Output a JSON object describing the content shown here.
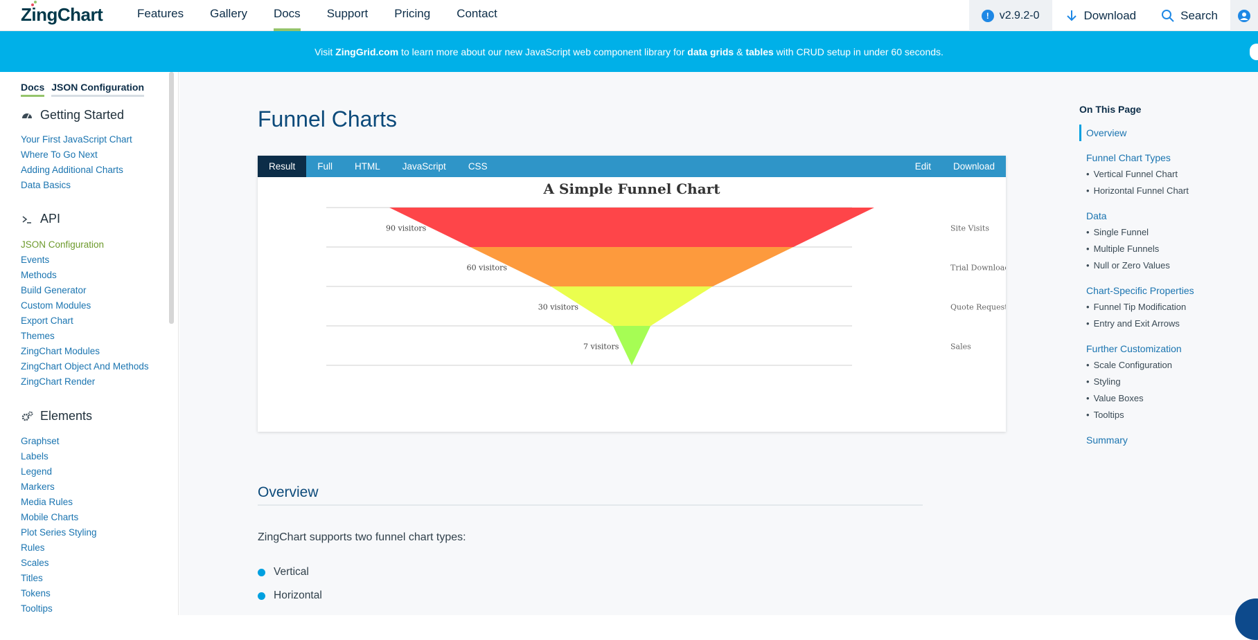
{
  "nav": {
    "logo": "ZingChart",
    "links": [
      "Features",
      "Gallery",
      "Docs",
      "Support",
      "Pricing",
      "Contact"
    ],
    "active": "Docs",
    "version": "v2.9.2-0",
    "download": "Download",
    "search": "Search"
  },
  "banner": {
    "t1": "Visit ",
    "link": "ZingGrid.com",
    "t2": " to learn more about our new JavaScript web component library for ",
    "b1": "data grids",
    "t3": " & ",
    "b2": "tables",
    "t4": " with CRUD setup in under 60 seconds."
  },
  "sidebar": {
    "tabs": [
      "Docs",
      "JSON Configuration"
    ],
    "sections": [
      {
        "title": "Getting Started",
        "icon": "dashboard-icon",
        "items": [
          "Your First JavaScript Chart",
          "Where To Go Next",
          "Adding Additional Charts",
          "Data Basics"
        ]
      },
      {
        "title": "API",
        "icon": "terminal-icon",
        "items": [
          "JSON Configuration",
          "Events",
          "Methods",
          "Build Generator",
          "Custom Modules",
          "Export Chart",
          "Themes",
          "ZingChart Modules",
          "ZingChart Object And Methods",
          "ZingChart Render"
        ]
      },
      {
        "title": "Elements",
        "icon": "gears-icon",
        "items": [
          "Graphset",
          "Labels",
          "Legend",
          "Markers",
          "Media Rules",
          "Mobile Charts",
          "Plot Series Styling",
          "Rules",
          "Scales",
          "Titles",
          "Tokens",
          "Tooltips"
        ]
      }
    ]
  },
  "main": {
    "title": "Funnel Charts",
    "demo_tabs": [
      "Result",
      "Full",
      "HTML",
      "JavaScript",
      "CSS"
    ],
    "demo_actions": [
      "Edit",
      "Download"
    ],
    "overview_heading": "Overview",
    "overview_text": "ZingChart supports two funnel chart types:",
    "overview_items": [
      "Vertical",
      "Horizontal"
    ]
  },
  "chart_data": {
    "type": "funnel",
    "title": "A Simple Funnel Chart",
    "categories": [
      "Site Visits",
      "Trial Downloads",
      "Quote Requests",
      "Sales"
    ],
    "values": [
      90,
      60,
      30,
      7
    ],
    "value_labels": [
      "90 visitors",
      "60 visitors",
      "30 visitors",
      "7 visitors"
    ],
    "colors": [
      "#fe4549",
      "#fd9a3d",
      "#eafe4e",
      "#a6fd54"
    ]
  },
  "toc": {
    "heading": "On This Page",
    "groups": [
      {
        "title": "Overview",
        "items": []
      },
      {
        "title": "Funnel Chart Types",
        "items": [
          "Vertical Funnel Chart",
          "Horizontal Funnel Chart"
        ]
      },
      {
        "title": "Data",
        "items": [
          "Single Funnel",
          "Multiple Funnels",
          "Null or Zero Values"
        ]
      },
      {
        "title": "Chart-Specific Properties",
        "items": [
          "Funnel Tip Modification",
          "Entry and Exit Arrows"
        ]
      },
      {
        "title": "Further Customization",
        "items": [
          "Scale Configuration",
          "Styling",
          "Value Boxes",
          "Tooltips"
        ]
      },
      {
        "title": "Summary",
        "items": []
      }
    ]
  }
}
